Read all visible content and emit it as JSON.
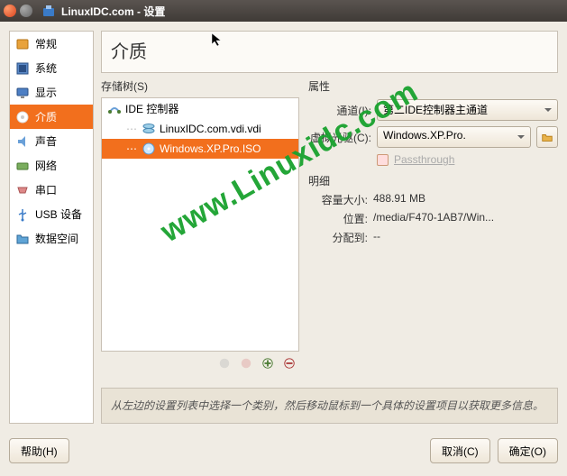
{
  "window": {
    "title": "LinuxIDC.com - 设置"
  },
  "sidebar": {
    "items": [
      {
        "label": "常规"
      },
      {
        "label": "系统"
      },
      {
        "label": "显示"
      },
      {
        "label": "介质"
      },
      {
        "label": "声音"
      },
      {
        "label": "网络"
      },
      {
        "label": "串口"
      },
      {
        "label": "USB 设备"
      },
      {
        "label": "数据空间"
      }
    ]
  },
  "main": {
    "title": "介质",
    "storage_tree_label": "存储树(S)",
    "attributes_label": "属性",
    "tree": {
      "controller": "IDE 控制器",
      "items": [
        {
          "label": "LinuxIDC.com.vdi.vdi"
        },
        {
          "label": "Windows.XP.Pro.ISO"
        }
      ]
    },
    "attrs": {
      "channel_label": "通道(I):",
      "channel_value": "第二IDE控制器主通道",
      "drive_label": "虚拟光驱(C):",
      "drive_value": "Windows.XP.Pro.",
      "passthrough": "Passthrough"
    },
    "details": {
      "heading": "明细",
      "size_label": "容量大小:",
      "size_value": "488.91 MB",
      "location_label": "位置:",
      "location_value": "/media/F470-1AB7/Win...",
      "attached_label": "分配到:",
      "attached_value": "--"
    },
    "hint": "从左边的设置列表中选择一个类别，然后移动鼠标到一个具体的设置项目以获取更多信息。"
  },
  "footer": {
    "help": "帮助(H)",
    "cancel": "取消(C)",
    "ok": "确定(O)"
  },
  "watermark": "www.Linuxidc.com"
}
